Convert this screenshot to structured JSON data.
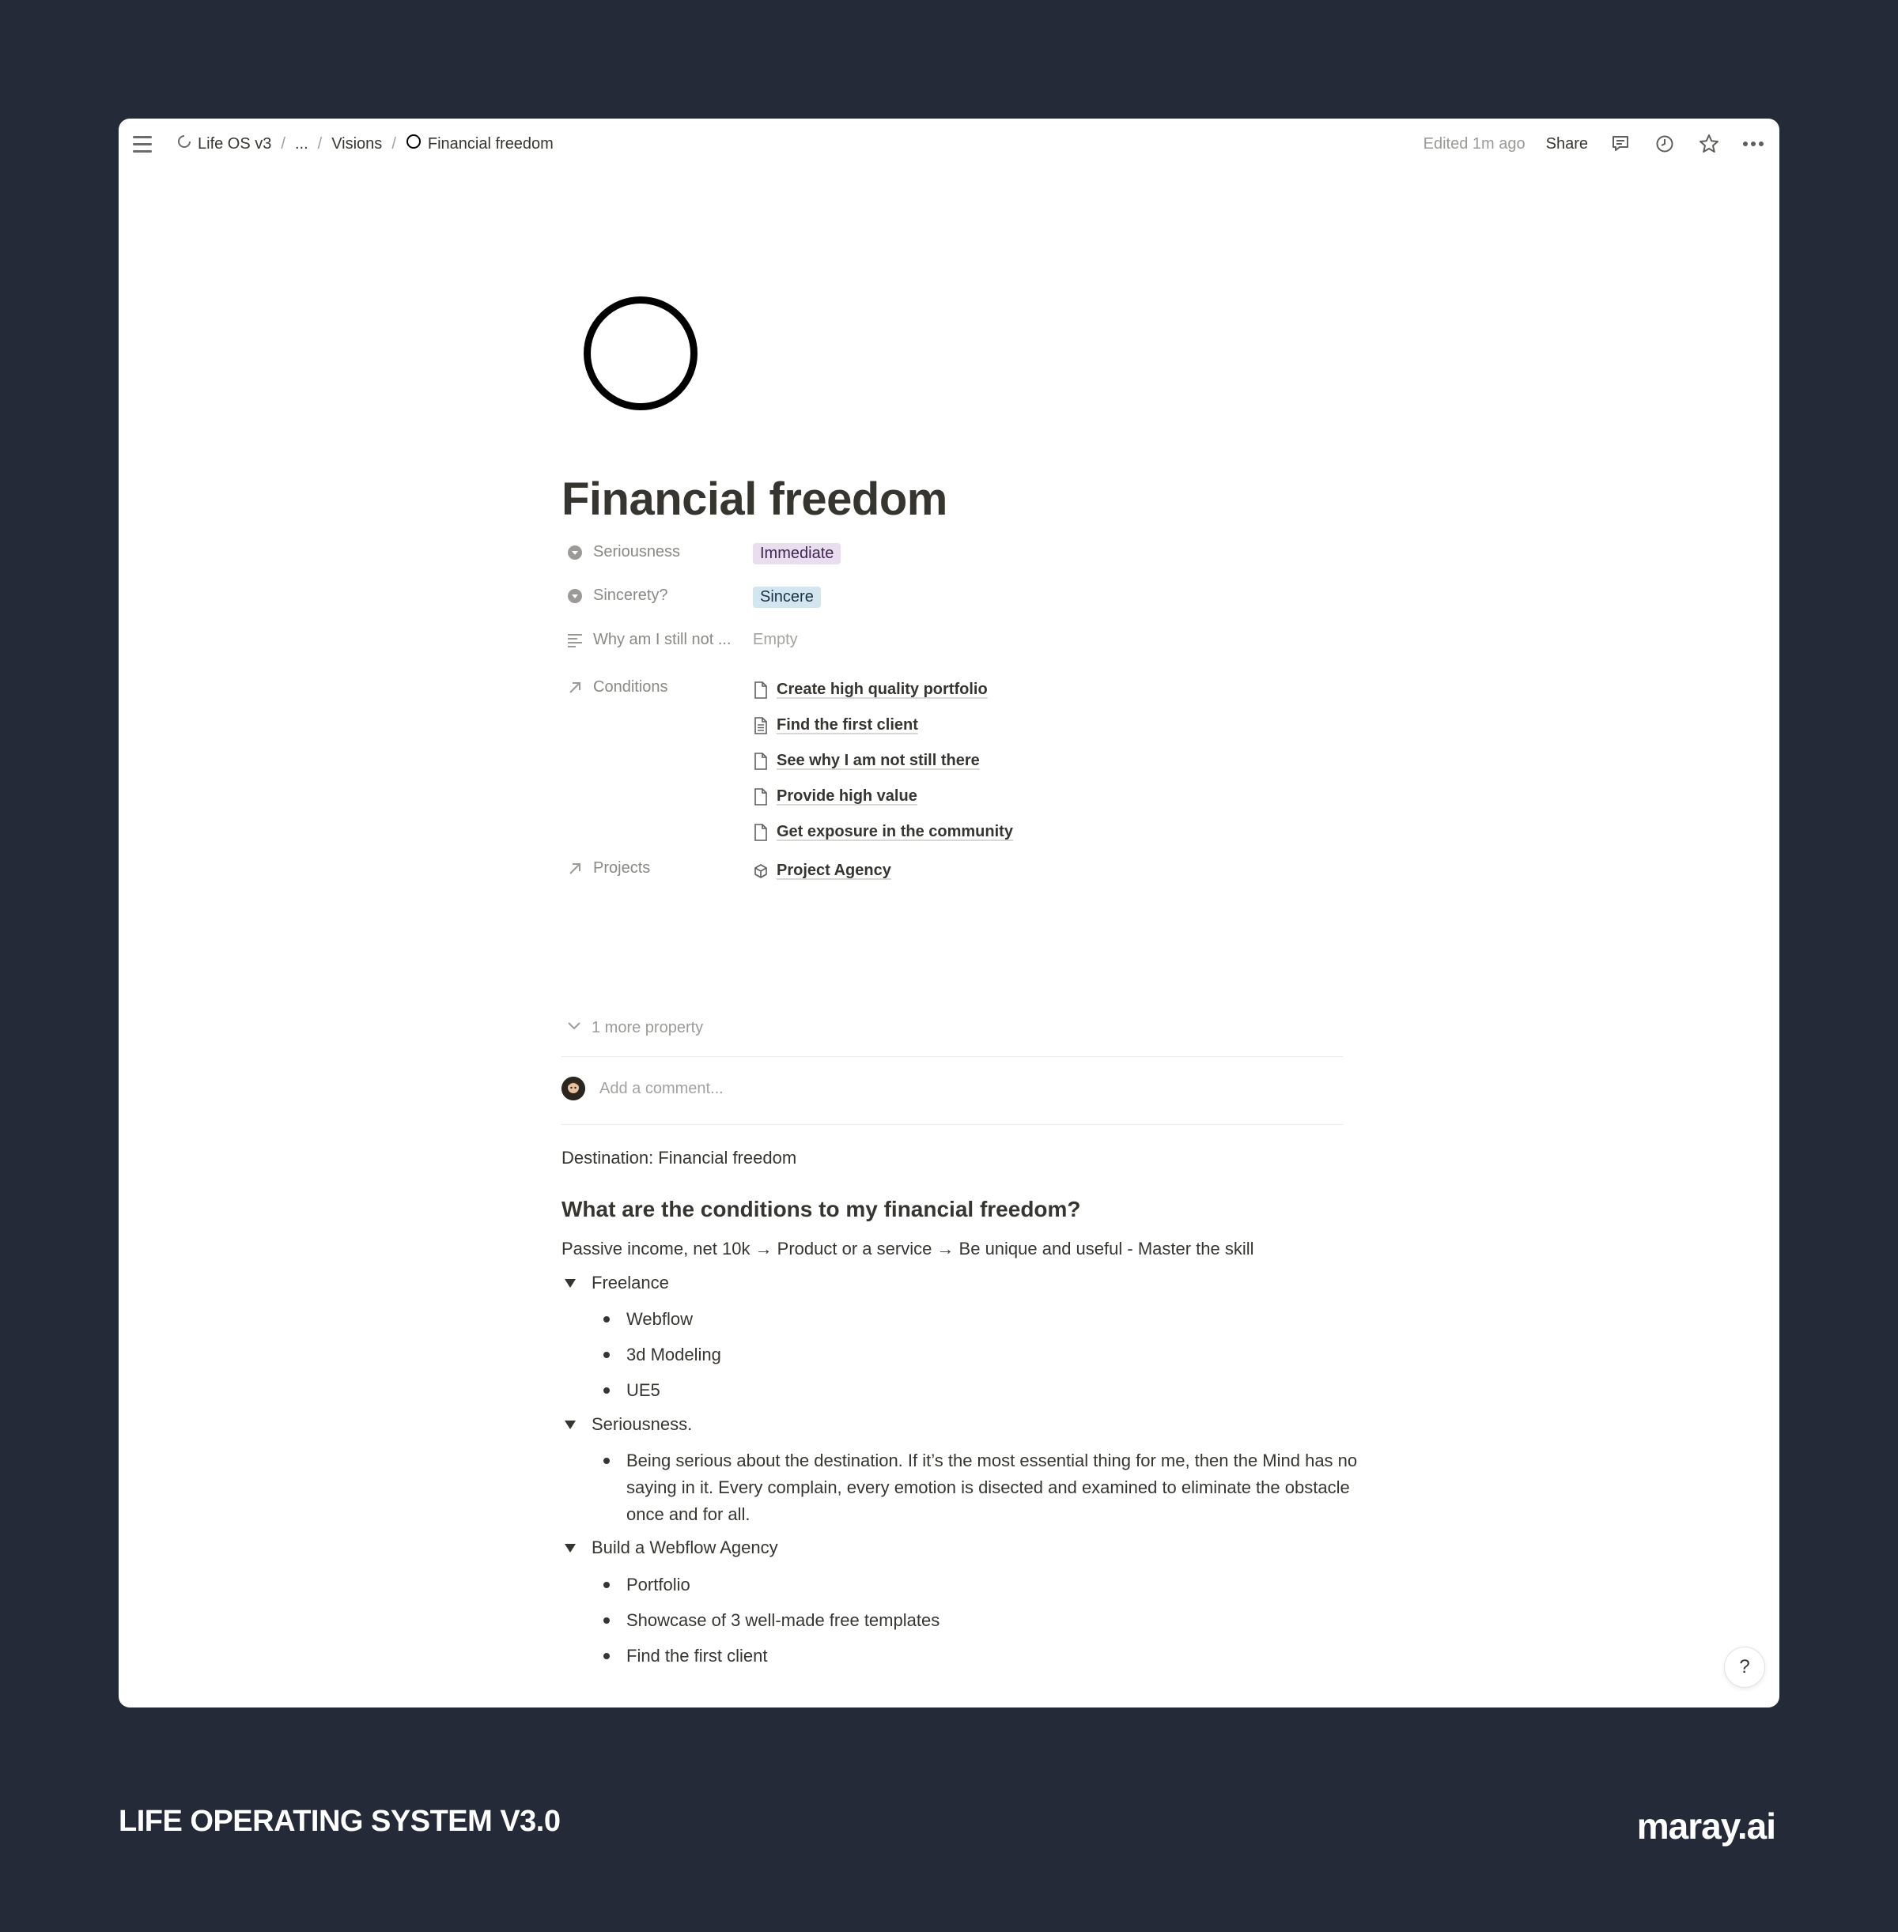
{
  "breadcrumb": {
    "workspace": "Life OS v3",
    "ellipsis": "...",
    "parent": "Visions",
    "current": "Financial freedom"
  },
  "topbar": {
    "edited": "Edited 1m ago",
    "share": "Share"
  },
  "page": {
    "title": "Financial freedom"
  },
  "properties": {
    "seriousness": {
      "label": "Seriousness",
      "value": "Immediate",
      "color": "#e8deee"
    },
    "sincerity": {
      "label": "Sincerety?",
      "value": "Sincere",
      "color": "#d3e5ef"
    },
    "why": {
      "label": "Why am I still not ...",
      "value": "Empty"
    },
    "conditions": {
      "label": "Conditions",
      "items": [
        "Create high quality portfolio",
        "Find the first client",
        "See why I am not still there",
        "Provide high value",
        "Get exposure in the community"
      ]
    },
    "projects": {
      "label": "Projects",
      "items": [
        "Project Agency"
      ]
    },
    "more": "1 more property"
  },
  "comment": {
    "placeholder": "Add a comment..."
  },
  "body": {
    "destination": "Destination: Financial freedom",
    "heading": "What are the conditions to my financial freedom?",
    "paragraph": "Passive income, net 10k → Product or a service → Be unique and useful - Master the skill",
    "toggles": [
      {
        "label": "Freelance",
        "items": [
          "Webflow",
          "3d Modeling",
          "UE5"
        ]
      },
      {
        "label": "Seriousness.",
        "items": [
          "Being serious about the destination. If it’s the most essential thing for me, then the Mind has no saying in it. Every complain, every emotion is disected and examined to eliminate the obstacle once and for all."
        ]
      },
      {
        "label": "Build a Webflow Agency",
        "items": [
          "Portfolio",
          "Showcase of 3 well-made free templates",
          "Find the first client"
        ]
      }
    ]
  },
  "help": "?",
  "footer": {
    "left": "LIFE OPERATING SYSTEM V3.0",
    "right": "maray.ai"
  }
}
